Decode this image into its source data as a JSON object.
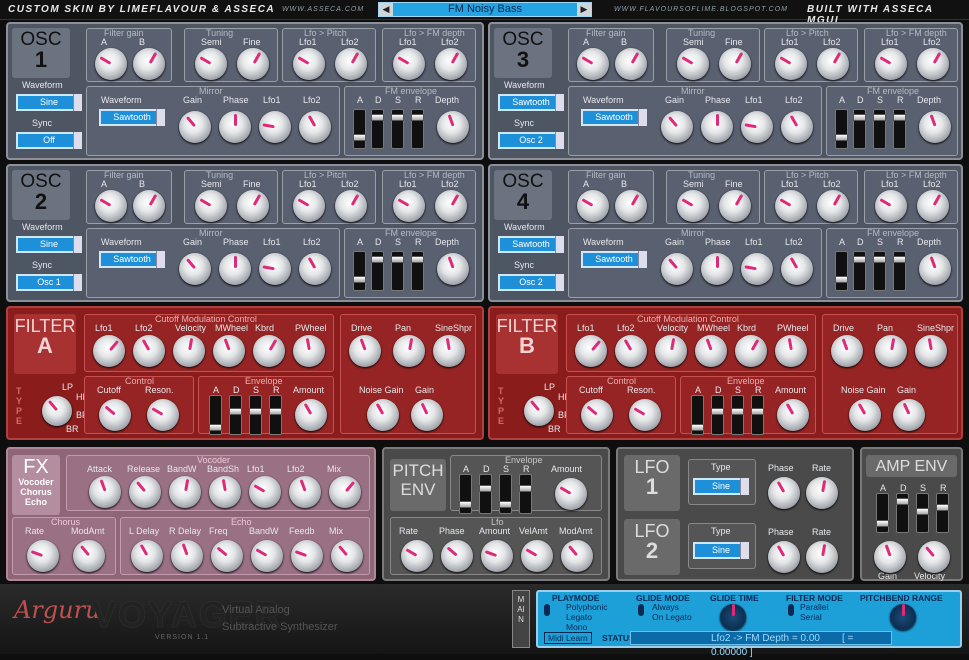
{
  "top": {
    "left": "CUSTOM SKIN BY LIMEFLAVOUR & ASSECA",
    "url1": "WWW.ASSECA.COM",
    "preset": "FM Noisy Bass",
    "url2": "WWW.FLAVOURSOFLIME.BLOGSPOT.COM",
    "right": "BUILT WITH ASSECA MGUI"
  },
  "osc": [
    {
      "title": "OSC",
      "num": "1",
      "waveform": "Sine",
      "sync": "Off",
      "wave2": "Sawtooth"
    },
    {
      "title": "OSC",
      "num": "2",
      "waveform": "Sine",
      "sync": "Osc 1",
      "wave2": "Sawtooth"
    },
    {
      "title": "OSC",
      "num": "3",
      "waveform": "Sawtooth",
      "sync": "Osc 2",
      "wave2": "Sawtooth"
    },
    {
      "title": "OSC",
      "num": "4",
      "waveform": "Sawtooth",
      "sync": "Osc 2",
      "wave2": "Sawtooth"
    }
  ],
  "osc_labels": {
    "filter_gain": "Filter gain",
    "a": "A",
    "b": "B",
    "tuning": "Tuning",
    "semi": "Semi",
    "fine": "Fine",
    "lfo_pitch": "Lfo > Pitch",
    "lfo1": "Lfo1",
    "lfo2": "Lfo2",
    "lfo_fm": "Lfo > FM depth",
    "waveform": "Waveform",
    "sync": "Sync",
    "mirror": "Mirror",
    "gain": "Gain",
    "phase": "Phase",
    "fm_env": "FM envelope",
    "d": "D",
    "s": "S",
    "r": "R",
    "depth": "Depth"
  },
  "filters": [
    {
      "title": "FILTER",
      "letter": "A"
    },
    {
      "title": "FILTER",
      "letter": "B"
    }
  ],
  "filter_labels": {
    "cutoff_mod": "Cutoff Modulation Control",
    "lfo1": "Lfo1",
    "lfo2": "Lfo2",
    "velocity": "Velocity",
    "mwheel": "MWheel",
    "kbrd": "Kbrd",
    "pwheel": "PWheel",
    "drive": "Drive",
    "pan": "Pan",
    "sineshpr": "SineShpr",
    "control": "Control",
    "cutoff": "Cutoff",
    "reson": "Reson.",
    "envelope": "Envelope",
    "a": "A",
    "d": "D",
    "s": "S",
    "r": "R",
    "amount": "Amount",
    "noise_gain": "Noise Gain",
    "gain": "Gain",
    "type": "TYPE",
    "lp": "LP",
    "hp": "HP",
    "bp": "BP",
    "br": "BR"
  },
  "fx": {
    "title": "FX",
    "sub1": "Vocoder",
    "sub2": "Chorus",
    "sub3": "Echo",
    "vocoder": "Vocoder",
    "attack": "Attack",
    "release": "Release",
    "bandw": "BandW",
    "bandsh": "BandSh",
    "lfo1": "Lfo1",
    "lfo2": "Lfo2",
    "mix": "Mix",
    "chorus": "Chorus",
    "rate": "Rate",
    "modamt": "ModAmt",
    "echo": "Echo",
    "ldelay": "L Delay",
    "rdelay": "R Delay",
    "freq": "Freq",
    "feedb": "Feedb"
  },
  "pitch": {
    "title1": "PITCH",
    "title2": "ENV",
    "envelope": "Envelope",
    "a": "A",
    "d": "D",
    "s": "S",
    "r": "R",
    "amount": "Amount",
    "lfo": "Lfo",
    "rate": "Rate",
    "phase": "Phase",
    "lamount": "Amount",
    "velamt": "VelAmt",
    "modamt": "ModAmt"
  },
  "lfos": [
    {
      "title": "LFO",
      "num": "1",
      "type_lbl": "Type",
      "type": "Sine",
      "phase": "Phase",
      "rate": "Rate"
    },
    {
      "title": "LFO",
      "num": "2",
      "type_lbl": "Type",
      "type": "Sine",
      "phase": "Phase",
      "rate": "Rate"
    }
  ],
  "amp": {
    "title": "AMP ENV",
    "a": "A",
    "d": "D",
    "s": "S",
    "r": "R",
    "gain": "Gain",
    "velocity": "Velocity"
  },
  "bottom": {
    "logo": "Arguru",
    "name": "VOYAGER",
    "version": "VERSION 1.1",
    "desc1": "Virtual Analog",
    "desc2": "Subtractive Synthesizer",
    "main": "MAIN",
    "playmode": "PLAYMODE",
    "pm1": "Polyphonic",
    "pm2": "Legato",
    "pm3": "Mono",
    "glidemode": "GLIDE MODE",
    "gm1": "Always",
    "gm2": "On Legato",
    "glidetime": "GLIDE TIME",
    "filtermode": "FILTER MODE",
    "fm1": "Parallel",
    "fm2": "Serial",
    "pitchbend": "PITCHBEND RANGE",
    "midi": "Midi Learn",
    "statusbar": "STATUSBAR",
    "status": "Lfo2 -> FM Depth = 0.00",
    "status_val": "[ = 0.00000 ]"
  },
  "colors": {
    "accent": "#e02a78",
    "blue": "#1e8fd9",
    "filter": "#8a1c1c"
  }
}
